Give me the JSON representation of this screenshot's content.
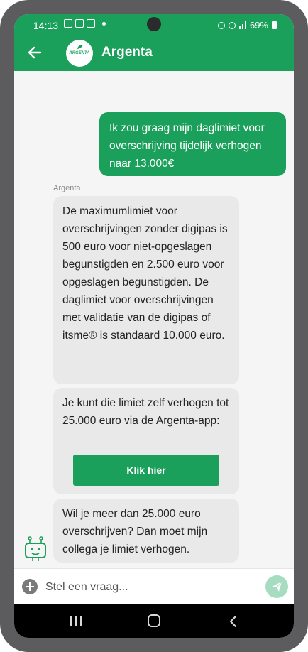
{
  "status_bar": {
    "time": "14:13",
    "battery": "69%"
  },
  "header": {
    "title": "Argenta",
    "logo_text": "ARGENTA"
  },
  "chat": {
    "user_message": "Ik zou graag mijn daglimiet voor overschrijving tijdelijk verhogen naar 13.000€",
    "sender_label": "Argenta",
    "bot_messages": [
      "De maximumlimiet voor overschrijvingen zonder digipas is 500 euro voor niet-opgeslagen begunstigden en 2.500 euro voor opgeslagen begunstigden. De daglimiet voor overschrijvingen met validatie van de digipas of itsme® is standaard 10.000 euro.",
      "Je kunt die limiet zelf verhogen tot 25.000 euro via de Argenta-app:",
      "Wil je meer dan 25.000 euro overschrijven? Dan moet mijn collega je limiet verhogen."
    ],
    "cta_label": "Klik hier"
  },
  "composer": {
    "placeholder": "Stel een vraag..."
  },
  "colors": {
    "brand": "#1aa05a",
    "bot_bubble": "#e9e9e9",
    "send_disabled": "#a6dcc0"
  },
  "icons": [
    "back-arrow-icon",
    "argenta-logo",
    "bot-avatar-icon",
    "add-icon",
    "send-icon",
    "recent-apps-icon",
    "home-icon",
    "nav-back-icon"
  ]
}
